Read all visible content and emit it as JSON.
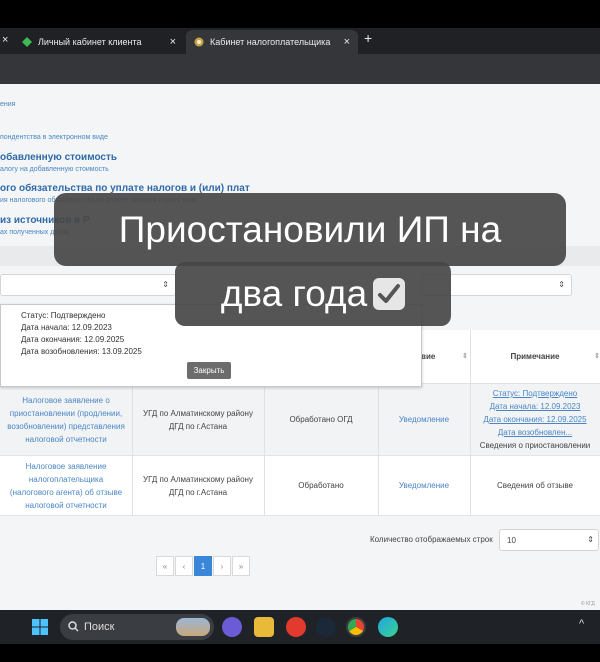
{
  "browser": {
    "tabs": [
      {
        "label": "Личный кабинет клиента",
        "close": "×"
      },
      {
        "label": "Кабинет налогоплательщика",
        "close": "×"
      }
    ],
    "new_tab": "+"
  },
  "page": {
    "links": [
      "ения",
      "пондентства в электронном виде",
      "обавленную стоимость",
      "алогу на добавленную стоимость",
      "ого обязательства по уплате налогов и (или) плат",
      "ия налогового обязательства по уплате налогов и (или) плат",
      "из источников в Р",
      "ах полученных доход"
    ]
  },
  "overlay": {
    "line1": "Приостановили ИП на",
    "line2": "два года"
  },
  "popup": {
    "status": "Статус: Подтверждено",
    "start": "Дата начала: 12.09.2023",
    "end": "Дата окончания: 12.09.2025",
    "resume": "Дата возобновления: 13.09.2025",
    "close_label": "Закрыть"
  },
  "table": {
    "headers": {
      "col4": "ствие",
      "col5": "Примечание"
    },
    "rows": [
      {
        "doc": "Налоговое заявление о приостановлении (продлении, возобновлении) представления налоговой отчетности",
        "org": "УГД по Алматинскому району ДГД по г.Астана",
        "state": "Обработано ОГД",
        "action": "Уведомление",
        "note_lines": [
          "Статус: Подтверждено",
          "Дата начала: 12.09.2023",
          "Дата окончания: 12.09.2025",
          "Дата возобновлен..."
        ],
        "note_extra": "Сведения о приостановлении"
      },
      {
        "doc": "Налоговое заявление налогоплательщика (налогового агента) об отзыве налоговой отчетности",
        "org": "УГД по Алматинскому району ДГД по г.Астана",
        "state": "Обработано",
        "action": "Уведомление",
        "note": "Сведения об отзыве"
      }
    ]
  },
  "pagination": {
    "first": "«",
    "prev": "‹",
    "current": "1",
    "next": "›",
    "last": "»",
    "rows_label": "Количество отображаемых строк",
    "rows_value": "10"
  },
  "footer": "© КГД",
  "taskbar": {
    "search": "Поиск"
  },
  "colors": {
    "link": "#4a86c5",
    "accent": "#3a86d8",
    "caption_bg": "#464646"
  }
}
